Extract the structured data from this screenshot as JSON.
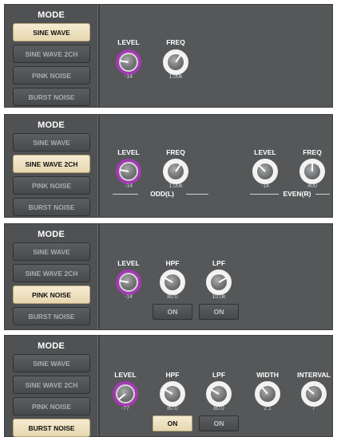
{
  "mode_title": "MODE",
  "mode_buttons": [
    "SINE WAVE",
    "SINE WAVE 2CH",
    "PINK NOISE",
    "BURST NOISE"
  ],
  "panels": [
    {
      "active_mode": "SINE WAVE",
      "knobs": [
        {
          "label": "LEVEL",
          "value": "-14",
          "style": "purple"
        },
        {
          "label": "FREQ",
          "value": "1.00k",
          "style": "white"
        }
      ]
    },
    {
      "active_mode": "SINE WAVE 2CH",
      "groups": [
        {
          "label": "ODD(L)",
          "knobs": [
            {
              "label": "LEVEL",
              "value": "-14",
              "style": "purple"
            },
            {
              "label": "FREQ",
              "value": "1.00k",
              "style": "white"
            }
          ]
        },
        {
          "label": "EVEN(R)",
          "knobs": [
            {
              "label": "LEVEL",
              "value": "-14",
              "style": "white"
            },
            {
              "label": "FREQ",
              "value": "400",
              "style": "white"
            }
          ]
        }
      ]
    },
    {
      "active_mode": "PINK NOISE",
      "knobs": [
        {
          "label": "LEVEL",
          "value": "-14",
          "style": "purple"
        },
        {
          "label": "HPF",
          "value": "80.0",
          "style": "white"
        },
        {
          "label": "LPF",
          "value": "10.0k",
          "style": "white"
        }
      ],
      "on_buttons": [
        {
          "label": "ON",
          "active": false
        },
        {
          "label": "ON",
          "active": false
        }
      ]
    },
    {
      "active_mode": "BURST NOISE",
      "knobs": [
        {
          "label": "LEVEL",
          "value": "-77",
          "style": "purple"
        },
        {
          "label": "HPF",
          "value": "80.0",
          "style": "white"
        },
        {
          "label": "LPF",
          "value": "80.0",
          "style": "white"
        },
        {
          "label": "WIDTH",
          "value": "2.1",
          "style": "white"
        },
        {
          "label": "INTERVAL",
          "value": "7",
          "style": "white"
        }
      ],
      "on_buttons": [
        {
          "label": "ON",
          "active": true
        },
        {
          "label": "ON",
          "active": false
        }
      ]
    }
  ]
}
